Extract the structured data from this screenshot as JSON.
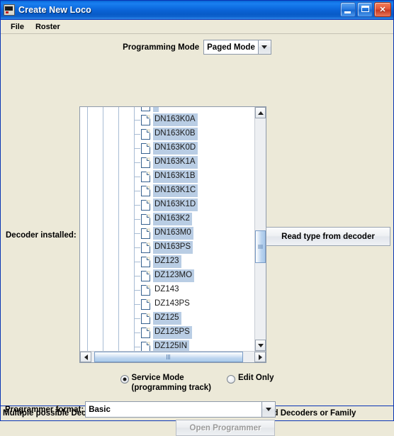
{
  "window": {
    "title": "Create New Loco",
    "icon": "locomotive-icon",
    "minimize_label": "Minimize",
    "maximize_label": "Maximize",
    "close_label": "Close"
  },
  "menubar": {
    "items": [
      {
        "label": "File"
      },
      {
        "label": "Roster"
      }
    ]
  },
  "programming_mode": {
    "label": "Programming Mode",
    "value": "Paged Mode"
  },
  "decoder": {
    "label": "Decoder installed:",
    "read_button": "Read type from decoder",
    "items": [
      {
        "label": "DN163K0A",
        "selected": true
      },
      {
        "label": "DN163K0B",
        "selected": true
      },
      {
        "label": "DN163K0D",
        "selected": true
      },
      {
        "label": "DN163K1A",
        "selected": true
      },
      {
        "label": "DN163K1B",
        "selected": true
      },
      {
        "label": "DN163K1C",
        "selected": true
      },
      {
        "label": "DN163K1D",
        "selected": true
      },
      {
        "label": "DN163K2",
        "selected": true
      },
      {
        "label": "DN163M0",
        "selected": true
      },
      {
        "label": "DN163PS",
        "selected": true
      },
      {
        "label": "DZ123",
        "selected": true
      },
      {
        "label": "DZ123MO",
        "selected": true
      },
      {
        "label": "DZ143",
        "selected": false
      },
      {
        "label": "DZ143PS",
        "selected": false
      },
      {
        "label": "DZ125",
        "selected": true
      },
      {
        "label": "DZ125PS",
        "selected": true
      },
      {
        "label": "DZ125IN",
        "selected": true
      }
    ]
  },
  "mode_options": {
    "service_mode_line1": "Service Mode",
    "service_mode_line2": "(programming track)",
    "service_mode_selected": true,
    "edit_only": "Edit Only",
    "edit_only_selected": false
  },
  "programmer_format": {
    "label": "Programmer format:",
    "value": "Basic"
  },
  "open_programmer": {
    "label": "Open Programmer",
    "enabled": false
  },
  "statusbar": {
    "message": "Multiple possible Decoders detected - Manually select from highlighted Decoders or Family"
  },
  "colors": {
    "titlebar_blue": "#0a62d4",
    "selection_blue": "#b9cde4",
    "window_face": "#ece9d8",
    "border_blue": "#0a35b5"
  }
}
